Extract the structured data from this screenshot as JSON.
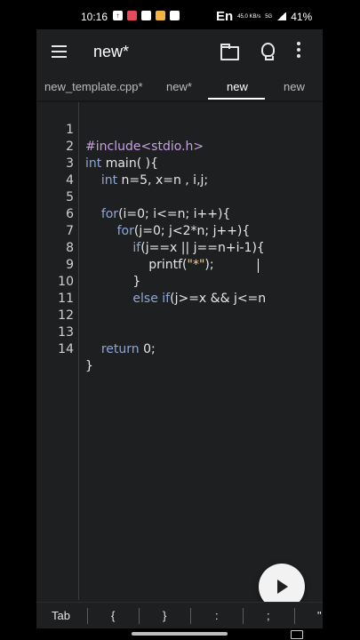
{
  "status": {
    "time": "10:16",
    "language": "En",
    "net_speed": "45.0 KB/s",
    "network": "5G",
    "battery": "41%"
  },
  "toolbar": {
    "title": "new*",
    "menu_icon": "hamburger-icon",
    "folder_icon": "folder-icon",
    "bulb_icon": "lightbulb-icon",
    "more_icon": "more-vertical-icon"
  },
  "tabs": [
    {
      "label": "new_template.cpp*"
    },
    {
      "label": "new*"
    },
    {
      "label": "new",
      "active": true
    },
    {
      "label": "new"
    }
  ],
  "editor": {
    "line_numbers": [
      "1",
      "2",
      "3",
      "4",
      "5",
      "6",
      "7",
      "8",
      "9",
      "10",
      "11",
      "12",
      "13",
      "14"
    ],
    "lines": [
      "#include<stdio.h>",
      "int main( ){",
      "    int n=5, x=n , i,j;",
      "",
      "    for(i=0; i<=n; i++){",
      "        for(j=0; j<2*n; j++){",
      "            if(j==x || j==n+i-1){",
      "                printf(\"*\");",
      "            }",
      "            else if(j>=x && j<=n",
      "",
      "",
      "    return 0;",
      "}"
    ]
  },
  "run_button": {
    "icon": "play-icon"
  },
  "symbols": [
    "Tab",
    "{",
    "}",
    ":",
    ";",
    "\""
  ]
}
